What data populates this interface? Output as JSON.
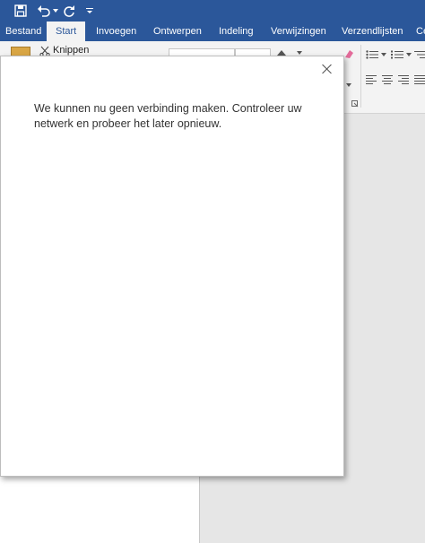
{
  "ribbon": {
    "tabs": [
      "Bestand",
      "Start",
      "Invoegen",
      "Ontwerpen",
      "Indeling",
      "Verwijzingen",
      "Verzendlijsten",
      "Ce"
    ],
    "active_tab": "Start",
    "cut_label": "Knippen"
  },
  "dialog": {
    "message": "We kunnen nu geen verbinding maken. Controleer uw netwerk en probeer het later opnieuw."
  },
  "colors": {
    "titlebar": "#2b579a",
    "ribbon": "#f3f3f3"
  }
}
